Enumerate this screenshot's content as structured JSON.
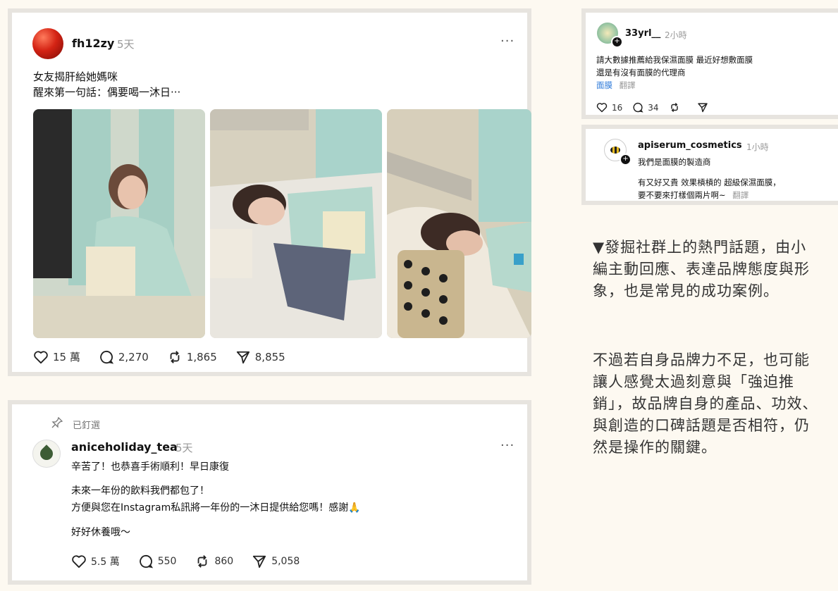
{
  "post": {
    "username": "fh12zy",
    "time": "5天",
    "more": "···",
    "line1": "女友揭肝給她媽咪",
    "line2": "醒來第一句話：偶要喝一沐日···",
    "likes": "15 萬",
    "comments": "2,270",
    "reposts": "1,865",
    "shares": "8,855"
  },
  "reply": {
    "pinned": "已釘選",
    "username": "aniceholiday_tea",
    "time": "5天",
    "more": "···",
    "line1": "辛苦了！也恭喜手術順利！早日康復",
    "line2": "未來一年份的飲料我們都包了！",
    "line3": "方便與您在Instagram私訊將一年份的一沐日提供給您嗎！感謝🙏",
    "line4": "好好休養哦～",
    "likes": "5.5 萬",
    "comments": "550",
    "reposts": "860",
    "shares": "5,058"
  },
  "snippet1": {
    "username": "33yrl__",
    "time": "2小時",
    "line1": "請大數據推薦給我保濕面膜 最近好想敷面膜",
    "line2": "還是有沒有面膜的代理商",
    "tag": "面膜",
    "translate": "翻譯",
    "likes": "16",
    "comments": "34"
  },
  "snippet2": {
    "username": "apiserum_cosmetics",
    "time": "1小時",
    "line1": "我們是面膜的製造商",
    "line2": "有又好又貴 效果槓槓的 超級保濕面膜，",
    "line3": "要不要來打樣個兩片啊~",
    "translate": "翻譯"
  },
  "description": {
    "para1": "▼發掘社群上的熱門話題，由小編主動回應、表達品牌態度與形象，也是常見的成功案例。",
    "para2": "不過若自身品牌力不足，也可能讓人感覺太過刻意與「強迫推銷」，故品牌自身的產品、功效、與創造的口碑話題是否相符，仍然是操作的關鍵。"
  },
  "colors": {
    "background": "#fdf9f1",
    "border": "#e7e4df",
    "tag": "#2d7ad9"
  }
}
